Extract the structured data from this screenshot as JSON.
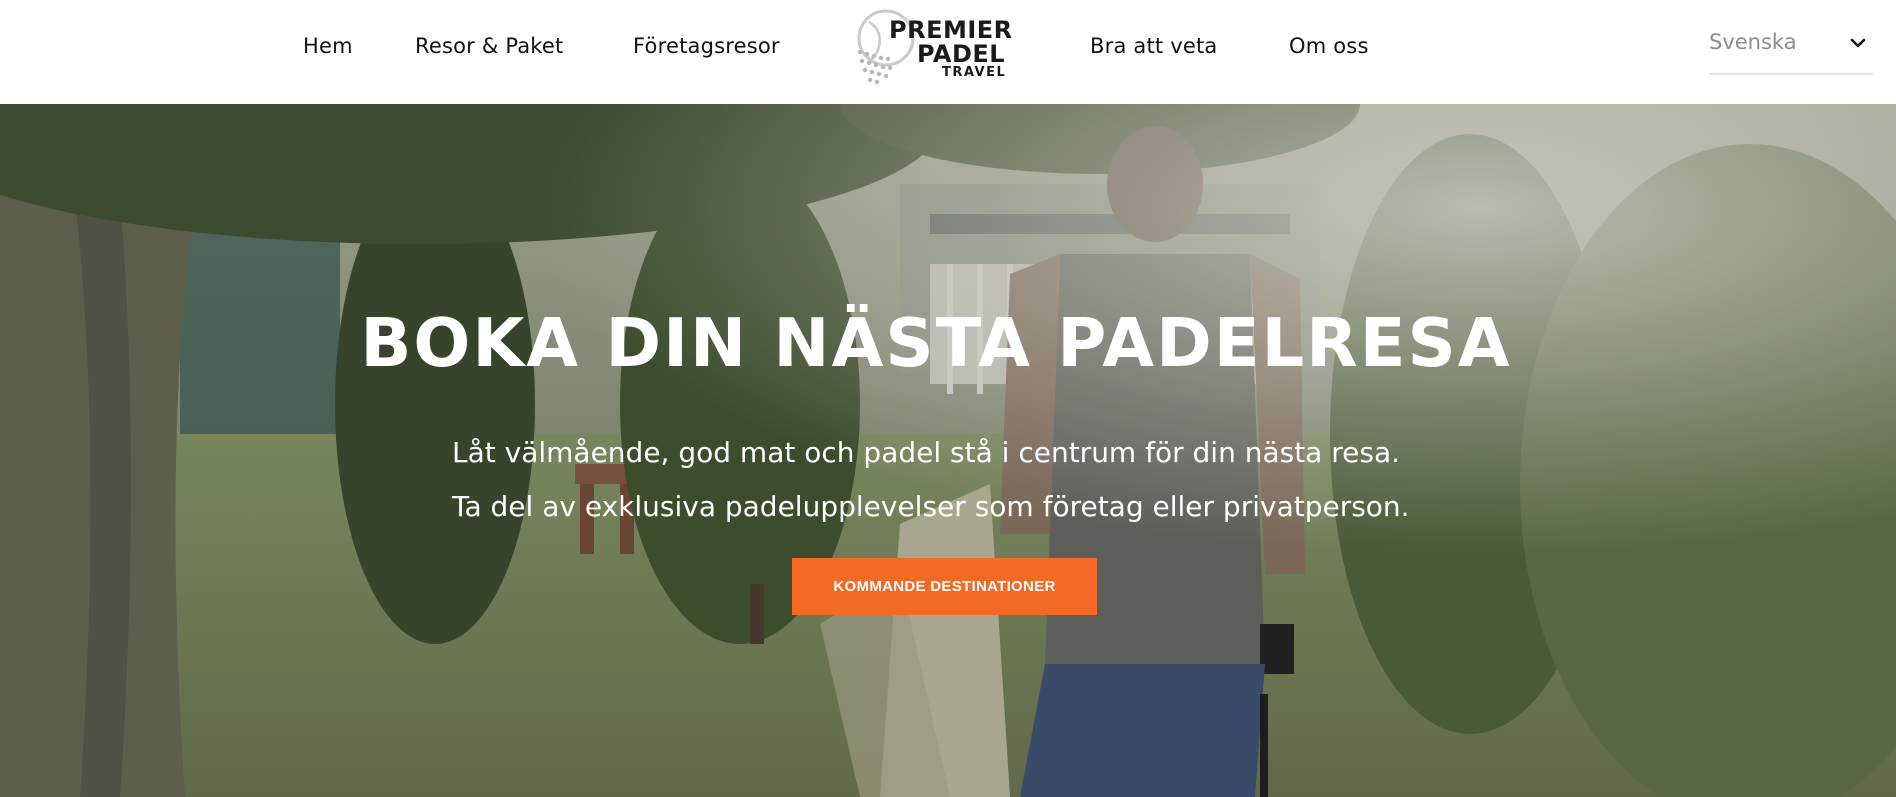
{
  "header": {
    "nav": {
      "home": "Hem",
      "trips": "Resor & Paket",
      "corporate": "Företagsresor",
      "good_to_know": "Bra att veta",
      "about": "Om oss"
    },
    "logo": {
      "line1": "PREMIER",
      "line2": "PADEL",
      "line3": "TRAVEL"
    },
    "language": {
      "selected": "Svenska",
      "icon": "chevron-down-icon"
    }
  },
  "hero": {
    "title": "BOKA DIN NÄSTA PADELRESA",
    "line1": "Låt välmående, god mat och padel stå i centrum för din nästa resa.",
    "line2": "Ta del av exklusiva padelupplevelser som företag eller privatperson.",
    "cta_label": "KOMMANDE DESTINATIONER"
  },
  "colors": {
    "accent": "#f26a24",
    "nav_text": "#111111",
    "muted": "#8a8d91"
  }
}
